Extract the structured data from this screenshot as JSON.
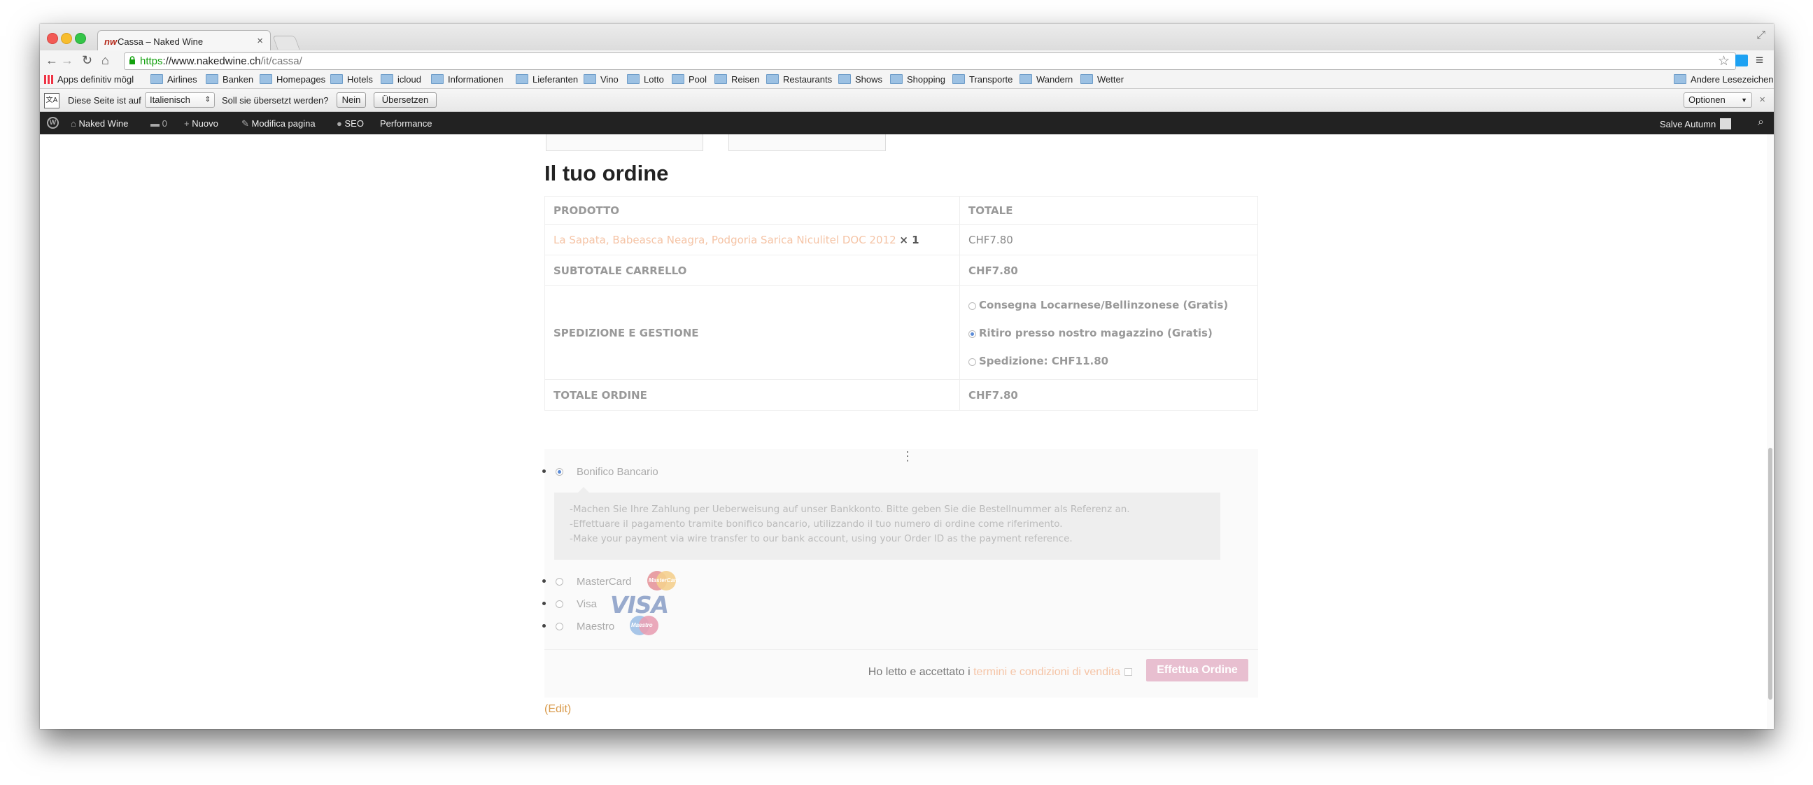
{
  "browser": {
    "tab_title": "Cassa – Naked Wine",
    "tab_favicon": "nw",
    "url_scheme": "https",
    "url_host": "://www.nakedwine.ch",
    "url_path": "/it/cassa/"
  },
  "bookmarks": {
    "apps": "Apps definitiv mögl",
    "items": [
      "Airlines",
      "Banken",
      "Homepages",
      "Hotels",
      "icloud",
      "Informationen",
      "Lieferanten",
      "Vino",
      "Lotto",
      "Pool",
      "Reisen",
      "Restaurants",
      "Shows",
      "Shopping",
      "Transporte",
      "Wandern",
      "Wetter"
    ],
    "other": "Andere Lesezeichen"
  },
  "translate": {
    "icon_text": "文A",
    "prefix": "Diese Seite ist auf",
    "language": "Italienisch",
    "question": "Soll sie übersetzt werden?",
    "no": "Nein",
    "translate": "Übersetzen",
    "options": "Optionen"
  },
  "adminbar": {
    "site": "Naked Wine",
    "comments": "0",
    "new": "Nuovo",
    "edit_page": "Modifica pagina",
    "seo": "SEO",
    "performance": "Performance",
    "greeting": "Salve Autumn"
  },
  "order": {
    "title": "Il tuo ordine",
    "head_product": "PRODOTTO",
    "head_total": "TOTALE",
    "product_name": "La Sapata, Babeasca Neagra, Podgoria Sarica Niculitel DOC 2012",
    "product_qty": "× 1",
    "product_total": "CHF7.80",
    "subtotal_label": "SUBTOTALE CARRELLO",
    "subtotal": "CHF7.80",
    "shipping_label": "SPEDIZIONE E GESTIONE",
    "shipping_options": [
      "Consegna Locarnese/Bellinzonese (Gratis)",
      "Ritiro presso nostro magazzino (Gratis)",
      "Spedizione: CHF11.80"
    ],
    "shipping_selected_index": 1,
    "total_label": "TOTALE ORDINE",
    "total": "CHF7.80"
  },
  "payment": {
    "methods": [
      "Bonifico Bancario",
      "MasterCard",
      "Visa",
      "Maestro"
    ],
    "selected_index": 0,
    "description": [
      "-Machen Sie Ihre Zahlung per Ueberweisung auf unser Bankkonto. Bitte geben Sie die Bestellnummer als Referenz an.",
      "-Effettuare il pagamento tramite bonifico bancario, utilizzando il tuo numero di ordine come riferimento.",
      "-Make your payment via wire transfer to our bank account, using your Order ID as the payment reference."
    ],
    "mastercard_logo": "MasterCard",
    "visa_logo": "VISA",
    "maestro_logo": "Maestro",
    "terms_prefix": "Ho letto e accettato i",
    "terms_link": "termini e condizioni di vendita",
    "place_order": "Effettua Ordine"
  },
  "edit_link": "(Edit)"
}
